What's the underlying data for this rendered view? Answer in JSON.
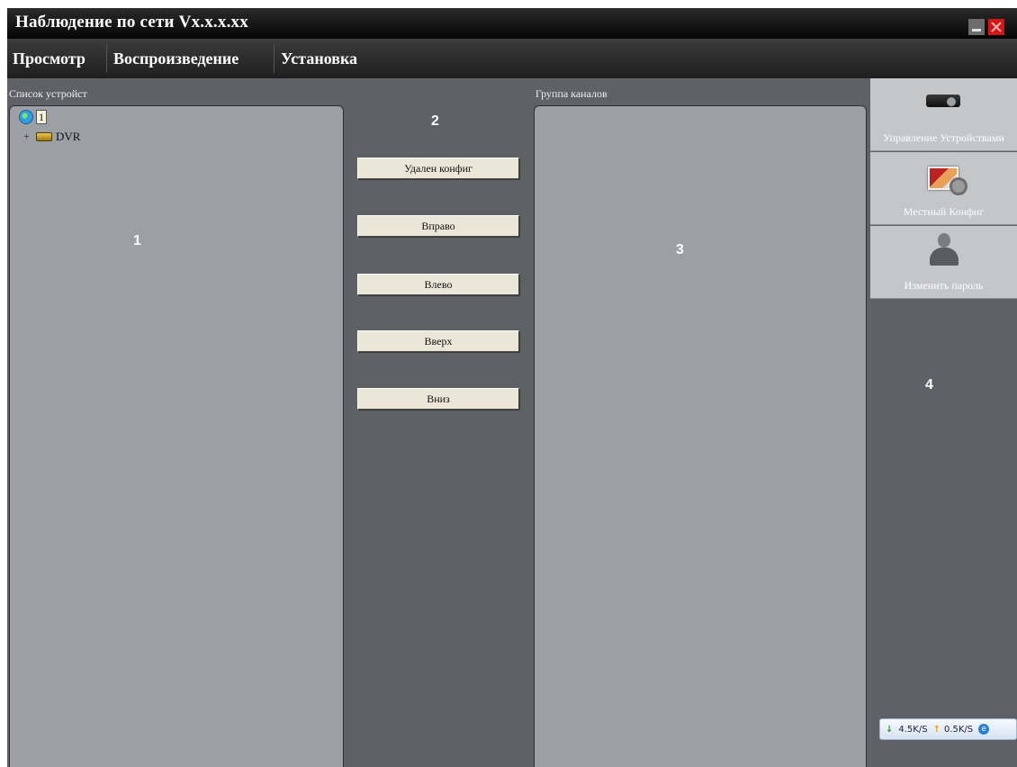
{
  "window": {
    "title": "Наблюдение по сети Vx.x.x.xx"
  },
  "menu": {
    "items": [
      "Просмотр",
      "Воспроизведение",
      "Установка"
    ]
  },
  "device_list": {
    "label": "Список устройст",
    "root": "1",
    "devices": [
      "DVR"
    ]
  },
  "channel_group": {
    "label": "Группа каналов"
  },
  "annotations": [
    "1",
    "2",
    "3",
    "4"
  ],
  "buttons": {
    "remote_config": "Удален конфиг",
    "right": "Вправо",
    "left": "Влево",
    "up": "Вверх",
    "down": "Вниз"
  },
  "sidebar": {
    "items": [
      {
        "label": "Управление Устройствами",
        "icon": "projector-icon"
      },
      {
        "label": "Местный Конфиг",
        "icon": "config-icon"
      },
      {
        "label": "Изменить пароль",
        "icon": "user-icon"
      }
    ]
  },
  "network": {
    "download": "4.5K/S",
    "upload": "0.5K/S"
  },
  "colors": {
    "background": "#5e6166",
    "panel": "#9c9fa4",
    "button": "#ebe7d8",
    "close": "#d61616"
  }
}
